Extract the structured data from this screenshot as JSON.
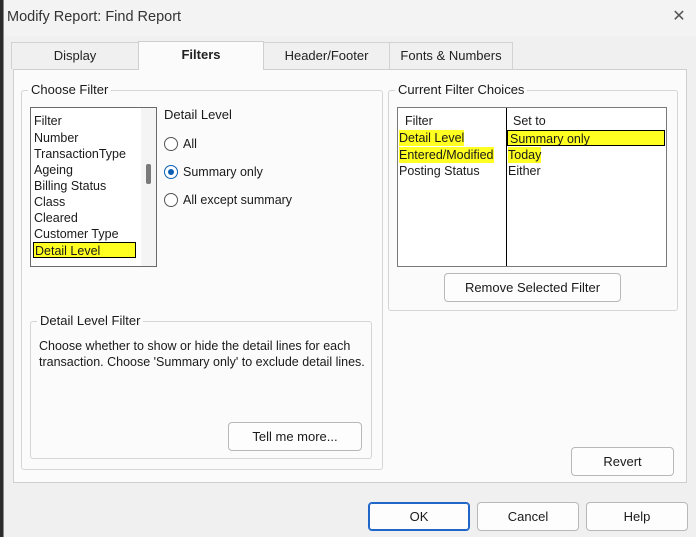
{
  "window": {
    "title": "Modify Report: Find Report",
    "close_icon": "close-icon"
  },
  "tabs": [
    {
      "label": "Display",
      "active": false
    },
    {
      "label": "Filters",
      "active": true
    },
    {
      "label": "Header/Footer",
      "active": false
    },
    {
      "label": "Fonts & Numbers",
      "active": false
    }
  ],
  "choose_filter": {
    "title": "Choose Filter",
    "list_header": "Filter",
    "items": [
      "Number",
      "TransactionType",
      "Ageing",
      "Billing Status",
      "Class",
      "Cleared",
      "Customer Type",
      "Detail Level"
    ],
    "selected": "Detail Level"
  },
  "detail_level": {
    "title": "Detail Level",
    "options": [
      "All",
      "Summary only",
      "All except summary"
    ],
    "selected": "Summary only"
  },
  "detail_level_filter": {
    "title": "Detail Level Filter",
    "description": "Choose whether to show or hide the detail lines for each transaction. Choose 'Summary only' to exclude detail lines.",
    "tell_me_more": "Tell me more..."
  },
  "current_filters": {
    "title": "Current Filter Choices",
    "col_filter": "Filter",
    "col_set_to": "Set to",
    "rows": [
      {
        "filter": "Detail Level",
        "set_to": "Summary only"
      },
      {
        "filter": "Entered/Modified",
        "set_to": "Today"
      },
      {
        "filter": "Posting Status",
        "set_to": "Either"
      }
    ],
    "remove_button": "Remove Selected Filter"
  },
  "buttons": {
    "revert": "Revert",
    "ok": "OK",
    "cancel": "Cancel",
    "help": "Help"
  },
  "colors": {
    "highlight": "#ffff21",
    "accent": "#1f66c8"
  }
}
